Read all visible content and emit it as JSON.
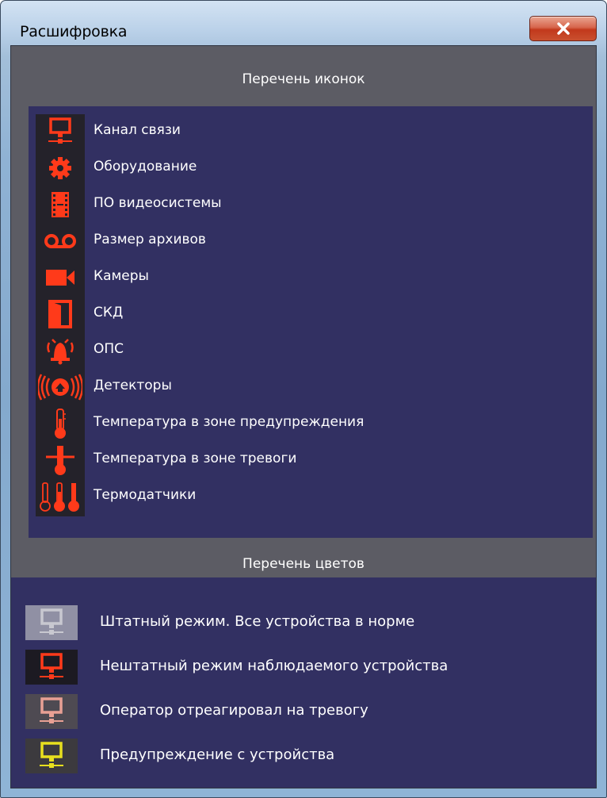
{
  "window": {
    "title": "Расшифровка",
    "close_icon": "close-x-icon"
  },
  "icons_section": {
    "header": "Перечень иконок",
    "items": [
      {
        "icon": "comm-channel-icon",
        "label": "Канал связи"
      },
      {
        "icon": "gear-icon",
        "label": "Оборудование"
      },
      {
        "icon": "film-icon",
        "label": "ПО видеосистемы"
      },
      {
        "icon": "tape-icon",
        "label": "Размер архивов"
      },
      {
        "icon": "video-camera-icon",
        "label": "Камеры"
      },
      {
        "icon": "door-icon",
        "label": "СКД"
      },
      {
        "icon": "alarm-bell-icon",
        "label": "ОПС"
      },
      {
        "icon": "detector-icon",
        "label": "Детекторы"
      },
      {
        "icon": "thermometer-warning-icon",
        "label": "Температура в зоне предупреждения"
      },
      {
        "icon": "thermometer-alarm-icon",
        "label": "Температура в зоне тревоги"
      },
      {
        "icon": "thermosensors-icon",
        "label": "Термодатчики"
      }
    ],
    "icon_color": "#ff3a1a"
  },
  "colors_section": {
    "header": "Перечень цветов",
    "items": [
      {
        "icon": "comm-channel-icon",
        "label": "Штатный режим. Все устройства в норме",
        "color": "#c8c8d0",
        "bg": "#9090a4"
      },
      {
        "icon": "comm-channel-icon",
        "label": "Нештатный режим наблюдаемого устройства",
        "color": "#ff3a1a",
        "bg": "#1c1a22"
      },
      {
        "icon": "comm-channel-icon",
        "label": "Оператор отреагировал на тревогу",
        "color": "#e8a094",
        "bg": "#4e4a52"
      },
      {
        "icon": "comm-channel-icon",
        "label": "Предупреждение с устройства",
        "color": "#e8e01e",
        "bg": "#3c3a3e"
      }
    ]
  }
}
